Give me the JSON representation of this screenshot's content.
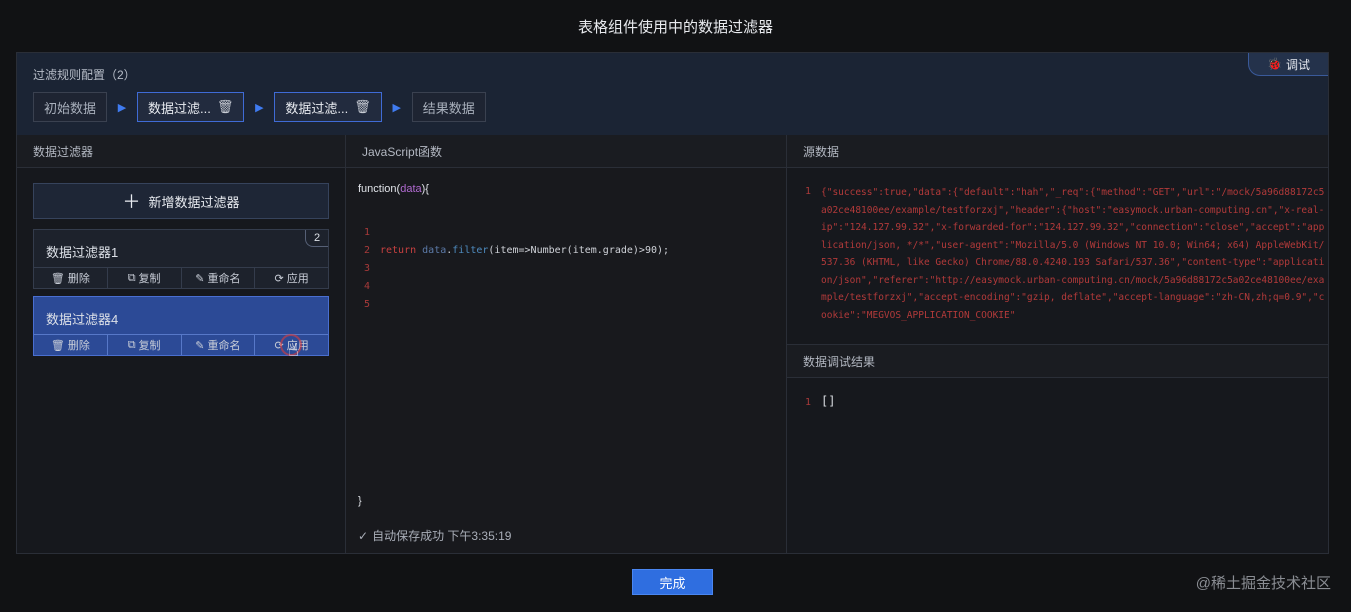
{
  "dialog": {
    "title": "表格组件使用中的数据过滤器"
  },
  "rules": {
    "title": "过滤规则配置（2）",
    "debug_label": "调试",
    "steps": [
      "初始数据",
      "数据过滤...",
      "数据过滤...",
      "结果数据"
    ]
  },
  "filters_panel": {
    "header": "数据过滤器",
    "add_label": "新增数据过滤器",
    "filters": [
      {
        "name": "数据过滤器1",
        "badge": "2"
      },
      {
        "name": "数据过滤器4"
      }
    ],
    "actions": {
      "delete": "删除",
      "copy": "复制",
      "rename": "重命名",
      "apply": "应用"
    }
  },
  "editor": {
    "header": "JavaScript函数",
    "fn_open": "function(",
    "fn_param": "data",
    "fn_close": "){",
    "line_numbers": [
      "1",
      "2",
      "3",
      "4",
      "5"
    ],
    "code_kw": "return",
    "code_var": "data",
    "code_method": "filter",
    "code_rest": "(item=>Number(item.grade)>90);",
    "closing": "}",
    "autosave": "自动保存成功 下午3:35:19"
  },
  "source": {
    "header": "源数据",
    "line": "1",
    "text": "{\"success\":true,\"data\":{\"default\":\"hah\",\"_req\":{\"method\":\"GET\",\"url\":\"/mock/5a96d88172c5a02ce48100ee/example/testforzxj\",\"header\":{\"host\":\"easymock.urban-computing.cn\",\"x-real-ip\":\"124.127.99.32\",\"x-forwarded-for\":\"124.127.99.32\",\"connection\":\"close\",\"accept\":\"application/json, */*\",\"user-agent\":\"Mozilla/5.0 (Windows NT 10.0; Win64; x64) AppleWebKit/537.36 (KHTML, like Gecko) Chrome/88.0.4240.193 Safari/537.36\",\"content-type\":\"application/json\",\"referer\":\"http://easymock.urban-computing.cn/mock/5a96d88172c5a02ce48100ee/example/testforzxj\",\"accept-encoding\":\"gzip, deflate\",\"accept-language\":\"zh-CN,zh;q=0.9\",\"cookie\":\"MEGVOS_APPLICATION_COOKIE\""
  },
  "result": {
    "header": "数据调试结果",
    "line": "1",
    "text": "[]"
  },
  "footer": {
    "done_label": "完成",
    "watermark": "@稀土掘金技术社区"
  }
}
